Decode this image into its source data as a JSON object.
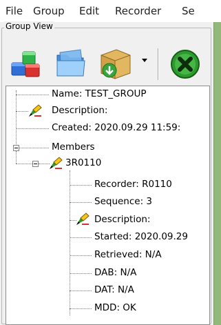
{
  "menu": {
    "items": [
      "File",
      "Group",
      "Edit",
      "Recorder",
      "Se"
    ]
  },
  "group_view": {
    "title": "Group View"
  },
  "toolbar": {
    "buttons": [
      {
        "icon": "database-stack-icon"
      },
      {
        "icon": "folder-icon"
      },
      {
        "icon": "package-download-icon"
      },
      {
        "icon": "close-circle-icon"
      }
    ]
  },
  "tree": {
    "group": {
      "name": "Name: TEST_GROUP",
      "description": "Description:",
      "created": "Created: 2020.09.29 11:59:",
      "members": "Members"
    },
    "recorder": {
      "label": "3R0110",
      "recorder": "Recorder: R0110",
      "sequence": "Sequence: 3",
      "description": "Description:",
      "started": "Started: 2020.09.29",
      "retrieved": "Retrieved: N/A",
      "dab": "DAB: N/A",
      "dat": "DAT: N/A",
      "mdd": "MDD: OK"
    }
  },
  "colors": {
    "green_pane": "#93b87c",
    "close_button": "#2e9a2e"
  }
}
